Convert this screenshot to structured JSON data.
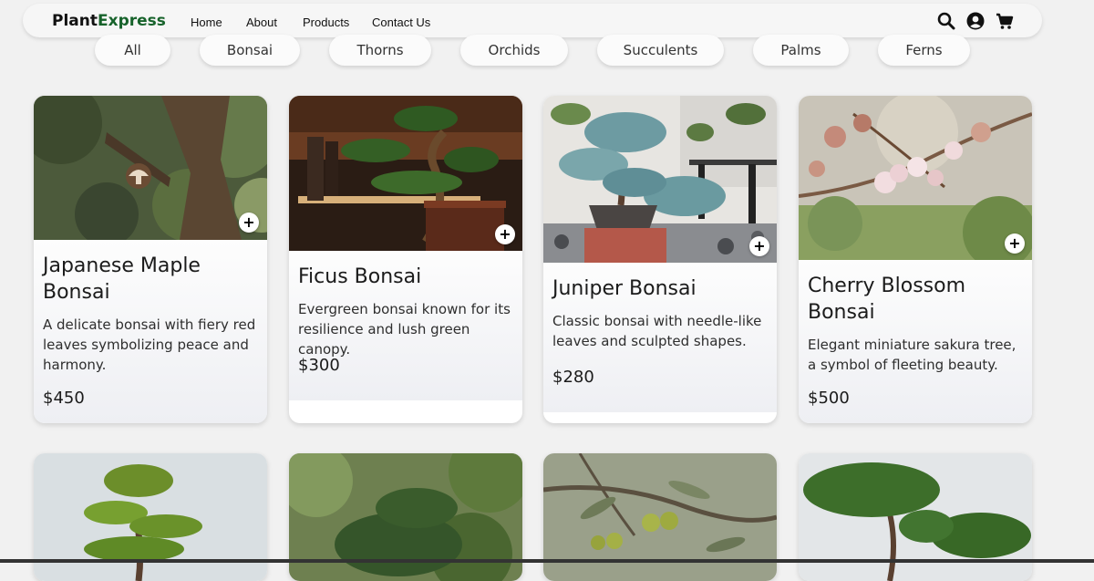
{
  "nav": {
    "brand_part1": "Plant",
    "brand_part2": "Express",
    "links": [
      "Home",
      "About",
      "Products",
      "Contact Us"
    ],
    "icons": [
      "search-icon",
      "user-icon",
      "cart-icon"
    ],
    "brand_color": "#17632b"
  },
  "filters": [
    "All",
    "Bonsai",
    "Thorns",
    "Orchids",
    "Succulents",
    "Palms",
    "Ferns"
  ],
  "products": [
    {
      "title": "Japanese Maple Bonsai",
      "description": "A delicate bonsai with fiery red leaves symbolizing peace and harmony.",
      "price": "$450"
    },
    {
      "title": "Ficus Bonsai",
      "description": "Evergreen bonsai known for its resilience and lush green canopy.",
      "price": "$300"
    },
    {
      "title": "Juniper Bonsai",
      "description": "Classic bonsai with needle-like leaves and sculpted shapes.",
      "price": "$280"
    },
    {
      "title": "Cherry Blossom Bonsai",
      "description": "Elegant miniature sakura tree, a symbol of fleeting beauty.",
      "price": "$500"
    }
  ],
  "add_button_label": "+"
}
